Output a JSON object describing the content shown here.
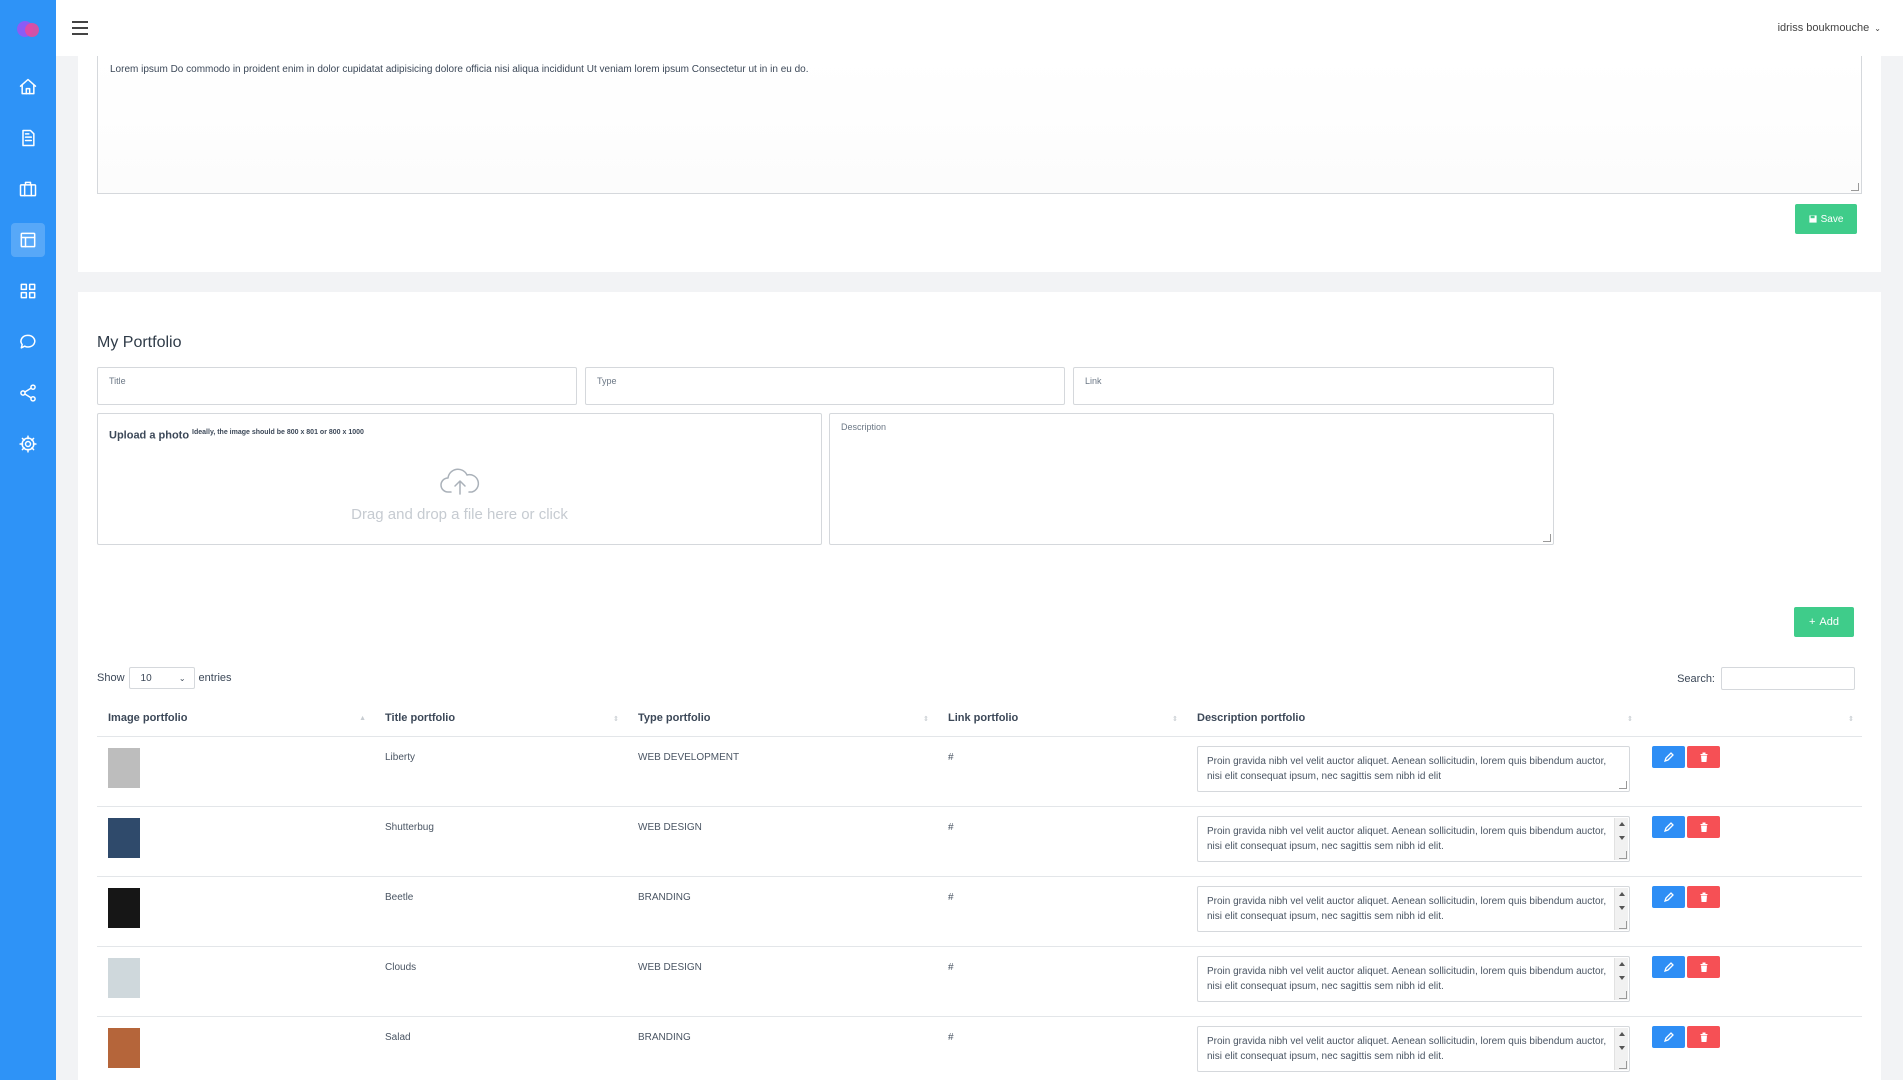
{
  "user": {
    "name": "idriss boukmouche"
  },
  "sidebar": {
    "items": [
      {
        "name": "home-icon",
        "active": false
      },
      {
        "name": "document-icon",
        "active": false
      },
      {
        "name": "briefcase-icon",
        "active": false
      },
      {
        "name": "layout-icon",
        "active": true
      },
      {
        "name": "grid-icon",
        "active": false
      },
      {
        "name": "chat-icon",
        "active": false
      },
      {
        "name": "share-icon",
        "active": false
      },
      {
        "name": "gear-icon",
        "active": false
      }
    ]
  },
  "about": {
    "text": "Lorem ipsum Do commodo in proident enim in dolor cupidatat adipisicing dolore officia nisi aliqua incididunt Ut veniam lorem ipsum Consectetur ut in in eu do.",
    "save_label": "Save"
  },
  "portfolio": {
    "title": "My Portfolio",
    "fields": {
      "title": "Title",
      "type": "Type",
      "link": "Link",
      "description": "Description"
    },
    "upload": {
      "label": "Upload a photo",
      "hint": "Ideally, the image should be 800 x 801 or 800 x 1000",
      "drop_message": "Drag and drop a file here or click"
    },
    "add_label": "Add"
  },
  "table": {
    "show_label": "Show",
    "length_value": "10",
    "entries_label": "entries",
    "search_label": "Search:",
    "columns": [
      "Image portfolio",
      "Title portfolio",
      "Type portfolio",
      "Link portfolio",
      "Description portfolio",
      ""
    ],
    "rows": [
      {
        "title": "Liberty",
        "type": "WEB DEVELOPMENT",
        "link": "#",
        "description": "Proin gravida nibh vel velit auctor aliquet. Aenean sollicitudin, lorem quis bibendum auctor, nisi elit consequat ipsum, nec sagittis sem nibh id elit",
        "thumb_color": "#bdbdbd"
      },
      {
        "title": "Shutterbug",
        "type": "WEB DESIGN",
        "link": "#",
        "description": "Proin gravida nibh vel velit auctor aliquet. Aenean sollicitudin, lorem quis bibendum auctor, nisi elit consequat ipsum, nec sagittis sem nibh id elit.",
        "thumb_color": "#2f4a6b"
      },
      {
        "title": "Beetle",
        "type": "BRANDING",
        "link": "#",
        "description": "Proin gravida nibh vel velit auctor aliquet. Aenean sollicitudin, lorem quis bibendum auctor, nisi elit consequat ipsum, nec sagittis sem nibh id elit.",
        "thumb_color": "#161616"
      },
      {
        "title": "Clouds",
        "type": "WEB DESIGN",
        "link": "#",
        "description": "Proin gravida nibh vel velit auctor aliquet. Aenean sollicitudin, lorem quis bibendum auctor, nisi elit consequat ipsum, nec sagittis sem nibh id elit.",
        "thumb_color": "#cfd8dc"
      },
      {
        "title": "Salad",
        "type": "BRANDING",
        "link": "#",
        "description": "Proin gravida nibh vel velit auctor aliquet. Aenean sollicitudin, lorem quis bibendum auctor, nisi elit consequat ipsum, nec sagittis sem nibh id elit.",
        "thumb_color": "#b5653a"
      }
    ]
  },
  "colors": {
    "sidebar": "#2e93f7",
    "success": "#3fcc8a",
    "primary": "#2e8ef5",
    "danger": "#f65055"
  }
}
